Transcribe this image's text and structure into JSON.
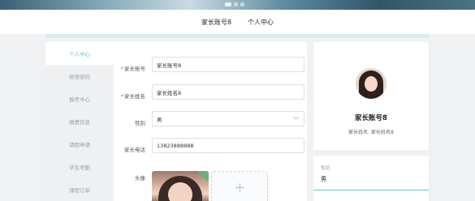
{
  "topnav": {
    "items": [
      {
        "label": "家长账号8"
      },
      {
        "label": "个人中心"
      }
    ]
  },
  "sidebar": {
    "items": [
      {
        "label": "个人中心",
        "active": true
      },
      {
        "label": "修改密码"
      },
      {
        "label": "报考中心"
      },
      {
        "label": "缴费信息"
      },
      {
        "label": "请假申请"
      },
      {
        "label": "学生考勤"
      },
      {
        "label": "课程订单"
      }
    ]
  },
  "form": {
    "account": {
      "label": "家长账号",
      "value": "家长账号8",
      "required": true
    },
    "name": {
      "label": "家长姓名",
      "value": "家长姓名8",
      "required": true
    },
    "gender": {
      "label": "性别",
      "value": "男"
    },
    "phone": {
      "label": "家长电话",
      "value": "13823888888"
    },
    "avatar": {
      "label": "头像"
    }
  },
  "profile": {
    "name": "家长账号8",
    "sub_label": "家长姓名",
    "sub_value": "家长姓名8"
  },
  "info": {
    "gender_label": "性别",
    "gender_value": "男"
  },
  "colors": {
    "accent": "#5fc4cc",
    "required": "#e5534b"
  }
}
